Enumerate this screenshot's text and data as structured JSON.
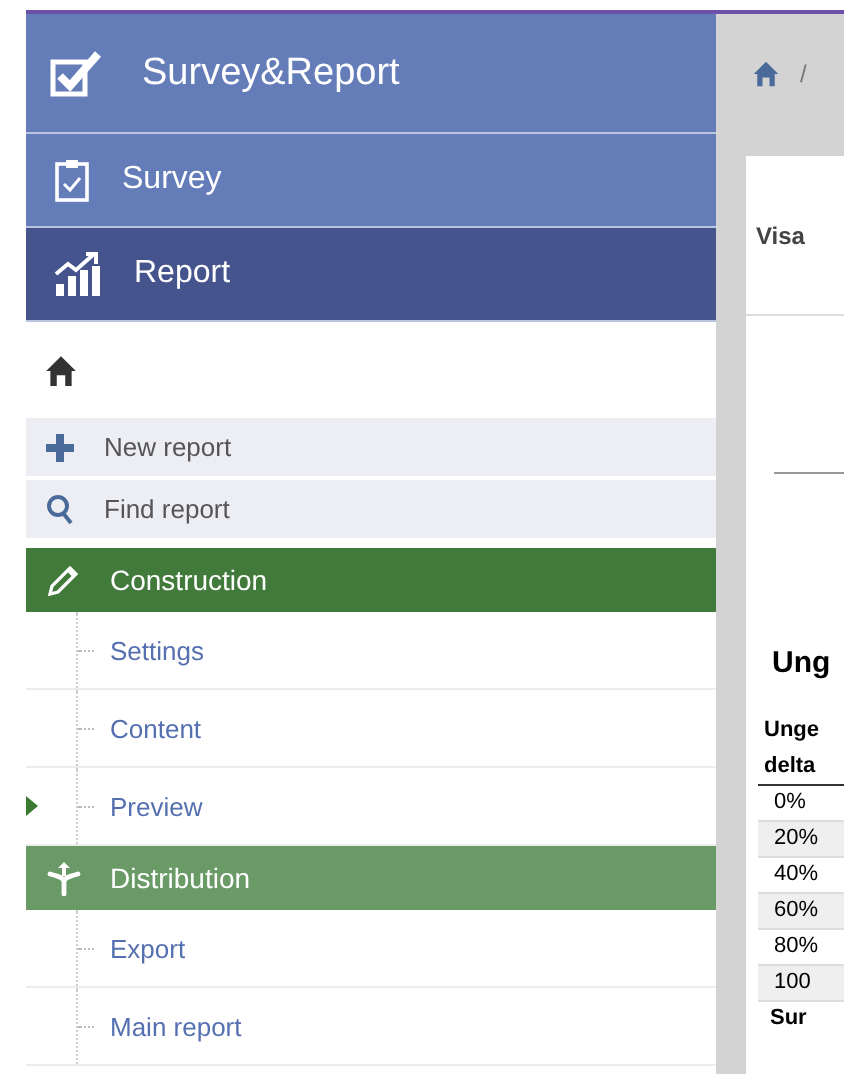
{
  "app": {
    "title": "Survey&Report"
  },
  "nav": [
    {
      "label": "Survey",
      "selected": false
    },
    {
      "label": "Report",
      "selected": true
    }
  ],
  "actions": [
    {
      "label": "New report"
    },
    {
      "label": "Find report"
    }
  ],
  "sections": [
    {
      "label": "Construction",
      "color": "#427a3c",
      "items": [
        {
          "label": "Settings",
          "selected": false
        },
        {
          "label": "Content",
          "selected": false
        },
        {
          "label": "Preview",
          "selected": true
        }
      ]
    },
    {
      "label": "Distribution",
      "color": "#6a9a66",
      "items": [
        {
          "label": "Export",
          "selected": false
        },
        {
          "label": "Main report",
          "selected": false
        }
      ]
    }
  ],
  "breadcrumb": {
    "separator": "/"
  },
  "panel": {
    "tab": "Visa",
    "heading": "Ung",
    "table": {
      "columns": [
        "Unge",
        "delta"
      ],
      "rows": [
        "0%",
        "20%",
        "40%",
        "60%",
        "80%",
        "100",
        "Sur"
      ]
    }
  }
}
